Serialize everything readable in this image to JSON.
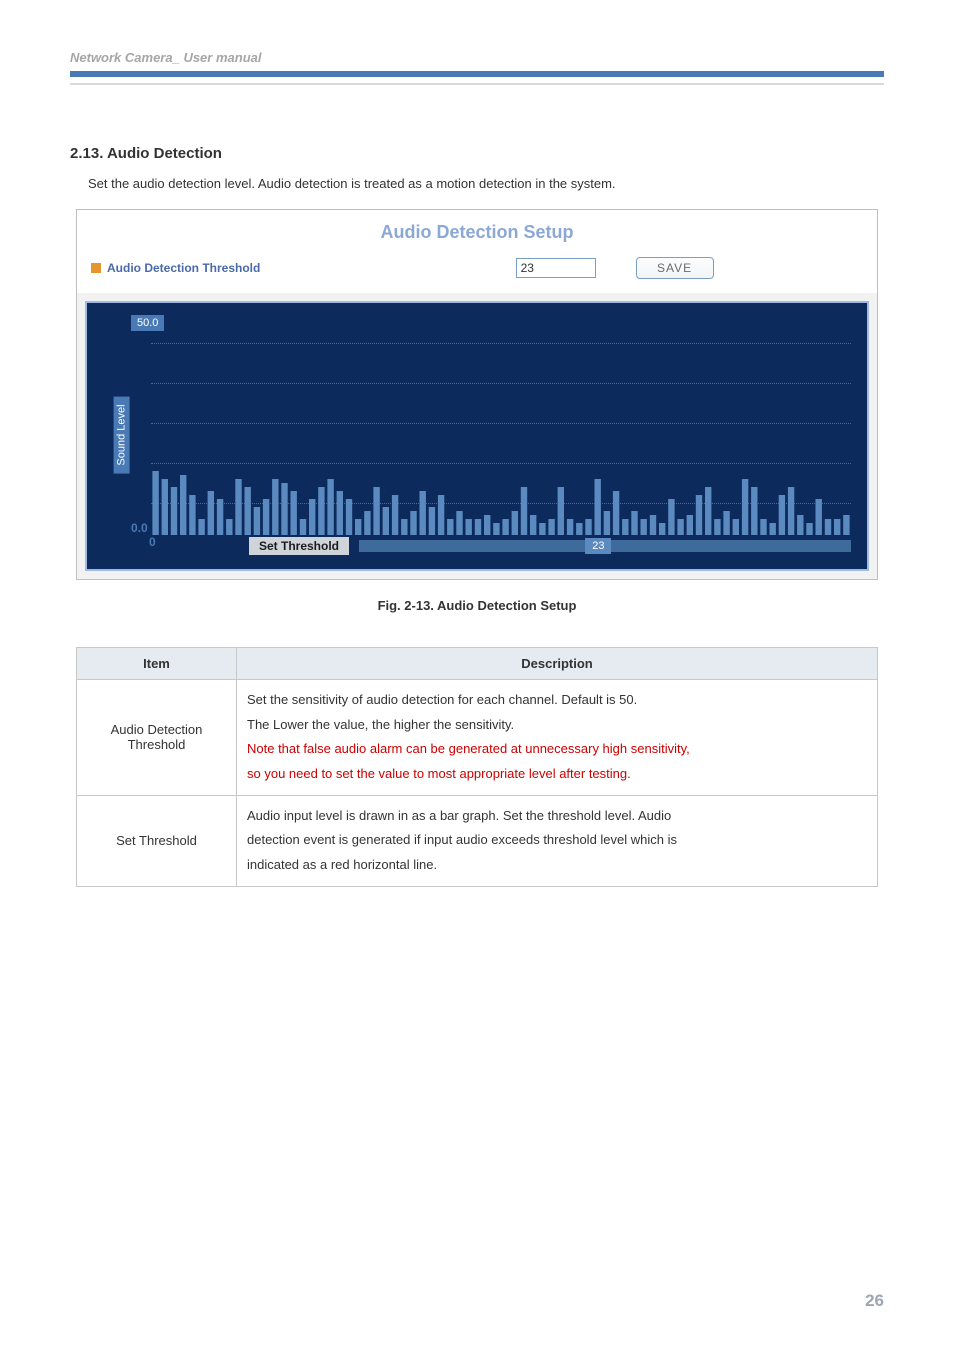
{
  "header": {
    "title": "Network Camera_ User manual"
  },
  "section": {
    "heading": "2.13. Audio Detection",
    "intro": "Set the audio detection level. Audio detection is treated as a motion detection in the system."
  },
  "panel": {
    "title": "Audio Detection Setup",
    "row_label": "Audio Detection Threshold",
    "threshold_value": "23",
    "save_label": "SAVE"
  },
  "chart": {
    "y_label": "Sound Level",
    "y_max": "50.0",
    "y_zero": "0.0",
    "x_zero": "0",
    "set_threshold_label": "Set Threshold",
    "marker_value": "23"
  },
  "figure_caption": "Fig. 2-13. Audio Detection Setup",
  "table": {
    "headers": {
      "item": "Item",
      "description": "Description"
    },
    "rows": [
      {
        "item": "Audio Detection Threshold",
        "line1": "Set the sensitivity of audio detection for each channel.   Default is 50.",
        "line2": "The Lower the value, the higher the sensitivity.",
        "red1": "Note that false audio alarm can be generated at unnecessary high sensitivity,",
        "red2": "so you need to set the value to most appropriate level after testing."
      },
      {
        "item": "Set Threshold",
        "line1": "Audio input level is drawn in as a bar graph. Set the threshold level. Audio",
        "line2": "detection event is generated if input audio exceeds threshold level which is",
        "line3": "indicated as a red horizontal line."
      }
    ]
  },
  "page_number": "26",
  "chart_data": {
    "type": "bar",
    "title": "Sound Level",
    "xlabel": "Set Threshold",
    "ylabel": "Sound Level",
    "ylim": [
      0,
      50
    ],
    "threshold_marker": 23,
    "categories_note": "time samples (unlabeled)",
    "values": [
      16,
      14,
      12,
      15,
      10,
      4,
      11,
      9,
      4,
      14,
      12,
      7,
      9,
      14,
      13,
      11,
      4,
      9,
      12,
      14,
      11,
      9,
      4,
      6,
      12,
      7,
      10,
      4,
      6,
      11,
      7,
      10,
      4,
      6,
      4,
      4,
      5,
      3,
      4,
      6,
      12,
      5,
      3,
      4,
      12,
      4,
      3,
      4,
      14,
      6,
      11,
      4,
      6,
      4,
      5,
      3,
      9,
      4,
      5,
      10,
      12,
      4,
      6,
      4,
      14,
      12,
      4,
      3,
      10,
      12,
      5,
      3,
      9,
      4,
      4,
      5
    ],
    "reference_lines": [
      {
        "label": "threshold",
        "value": 23,
        "axis_label": "23"
      }
    ]
  }
}
